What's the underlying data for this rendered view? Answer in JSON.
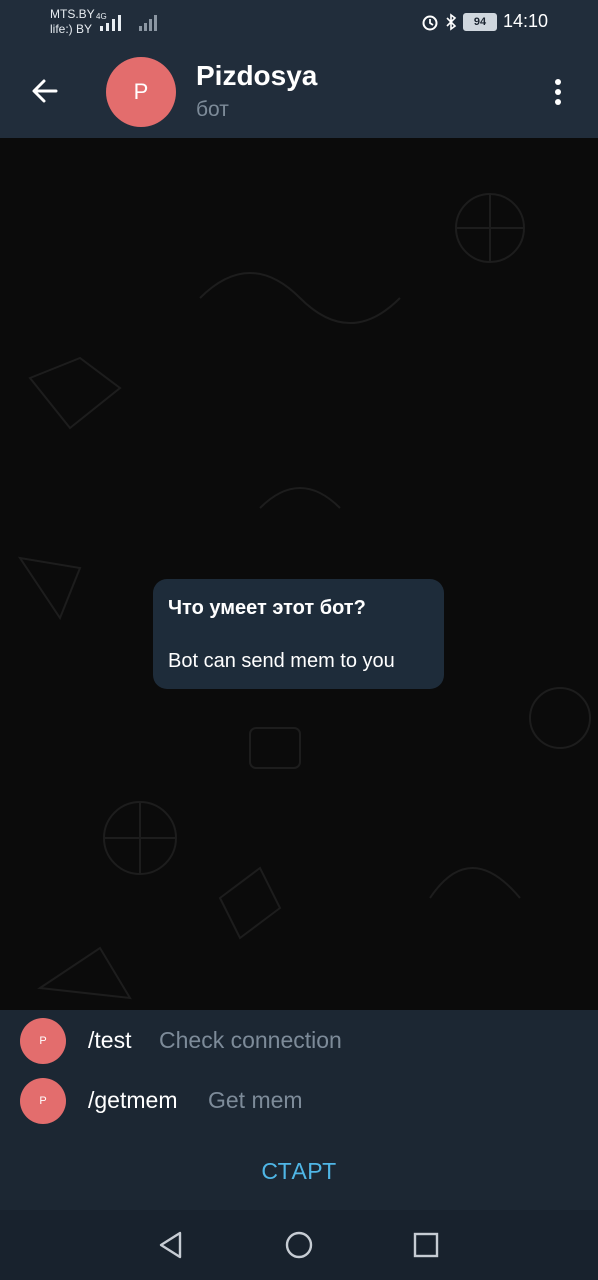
{
  "status_bar": {
    "carrier1": "MTS.BY",
    "carrier2": "life:) BY",
    "network_type": "4G",
    "battery": "94",
    "time": "14:10",
    "icons": [
      "signal-icon",
      "alarm-icon",
      "bluetooth-icon",
      "battery-icon"
    ]
  },
  "header": {
    "avatar_letter": "P",
    "title": "Pizdosya",
    "subtitle": "бот",
    "avatar_color": "#e36d6d"
  },
  "bot_info": {
    "title": "Что умеет этот бот?",
    "description": "Bot can send mem to you"
  },
  "commands": [
    {
      "avatar": "P",
      "name": "/test",
      "description": "Check connection"
    },
    {
      "avatar": "P",
      "name": "/getmem",
      "description": "Get mem"
    }
  ],
  "start_button": {
    "label": "СТАРТ",
    "color": "#4fb6e6"
  },
  "nav": {
    "icons": [
      "back-triangle-icon",
      "home-circle-icon",
      "recents-square-icon"
    ]
  }
}
